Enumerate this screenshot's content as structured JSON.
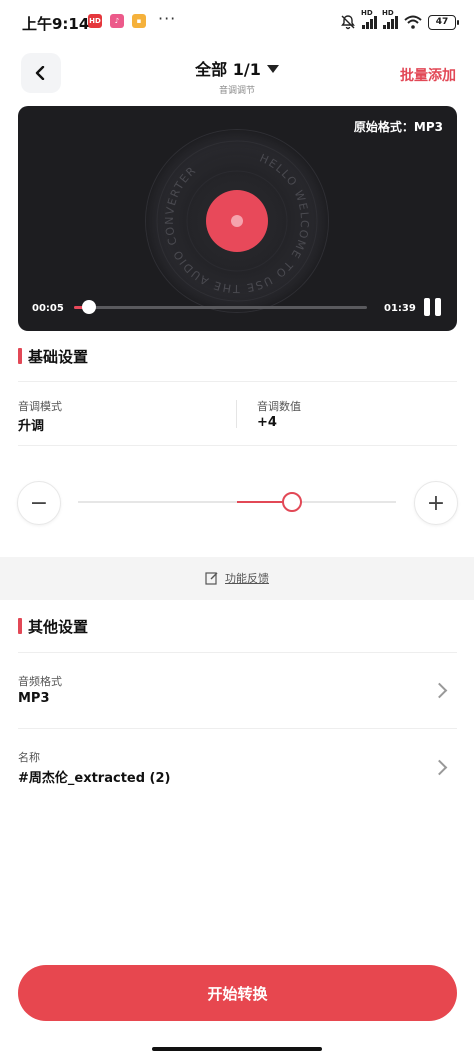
{
  "status_bar": {
    "time": "上午9:14",
    "dots": "···",
    "battery": "47",
    "signal_label": "HD"
  },
  "header": {
    "title": "全部 1/1",
    "subtitle": "音调调节",
    "batch_add": "批量添加"
  },
  "player": {
    "original_format": "原始格式：MP3",
    "disc_text": "HELLO WELCOME TO USE THE AUDIO CONVERTER",
    "current_time": "00:05",
    "total_time": "01:39",
    "progress_fraction": 0.05
  },
  "basic_settings": {
    "title": "基础设置",
    "pitch_mode_label": "音调模式",
    "pitch_mode_value": "升调",
    "pitch_value_label": "音调数值",
    "pitch_value": "+4",
    "minus": "−",
    "plus": "+",
    "slider_fraction": 0.67
  },
  "feedback": {
    "label": "功能反馈"
  },
  "other_settings": {
    "title": "其他设置",
    "audio_format_label": "音频格式",
    "audio_format_value": "MP3",
    "name_label": "名称",
    "name_value": "#周杰伦_extracted (2)"
  },
  "actions": {
    "start": "开始转换"
  },
  "colors": {
    "accent": "#e24856",
    "button": "#e7474f",
    "player_bg": "#1d1d20"
  }
}
